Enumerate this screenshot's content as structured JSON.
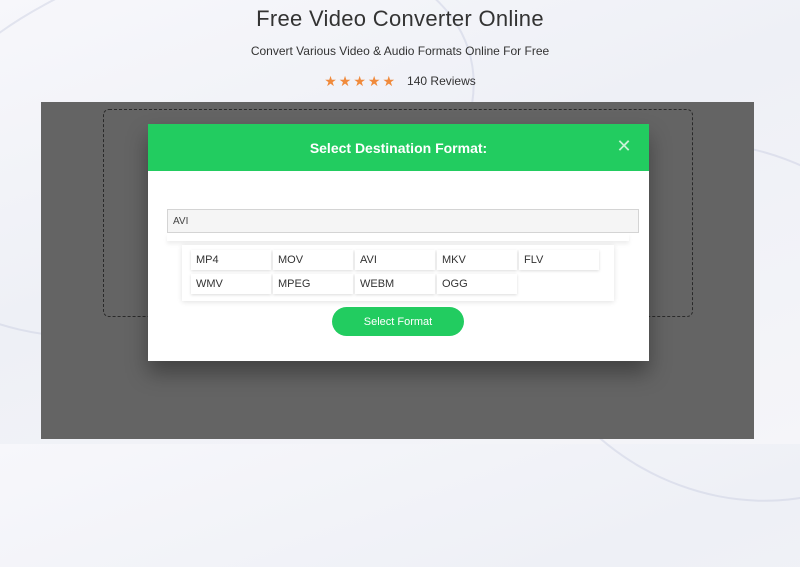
{
  "header": {
    "title": "Free Video Converter Online",
    "subtitle": "Convert Various Video & Audio Formats Online For Free",
    "rating": {
      "stars": 5,
      "reviews_label": "140 Reviews"
    }
  },
  "modal": {
    "title": "Select Destination Format:",
    "close_icon": "close-icon",
    "input_value": "AVI",
    "formats": [
      "MP4",
      "MOV",
      "AVI",
      "MKV",
      "FLV",
      "WMV",
      "MPEG",
      "WEBM",
      "OGG"
    ],
    "button_label": "Select Format"
  },
  "colors": {
    "accent": "#22cc60",
    "star": "#f08a3c",
    "overlay": "#646464"
  }
}
